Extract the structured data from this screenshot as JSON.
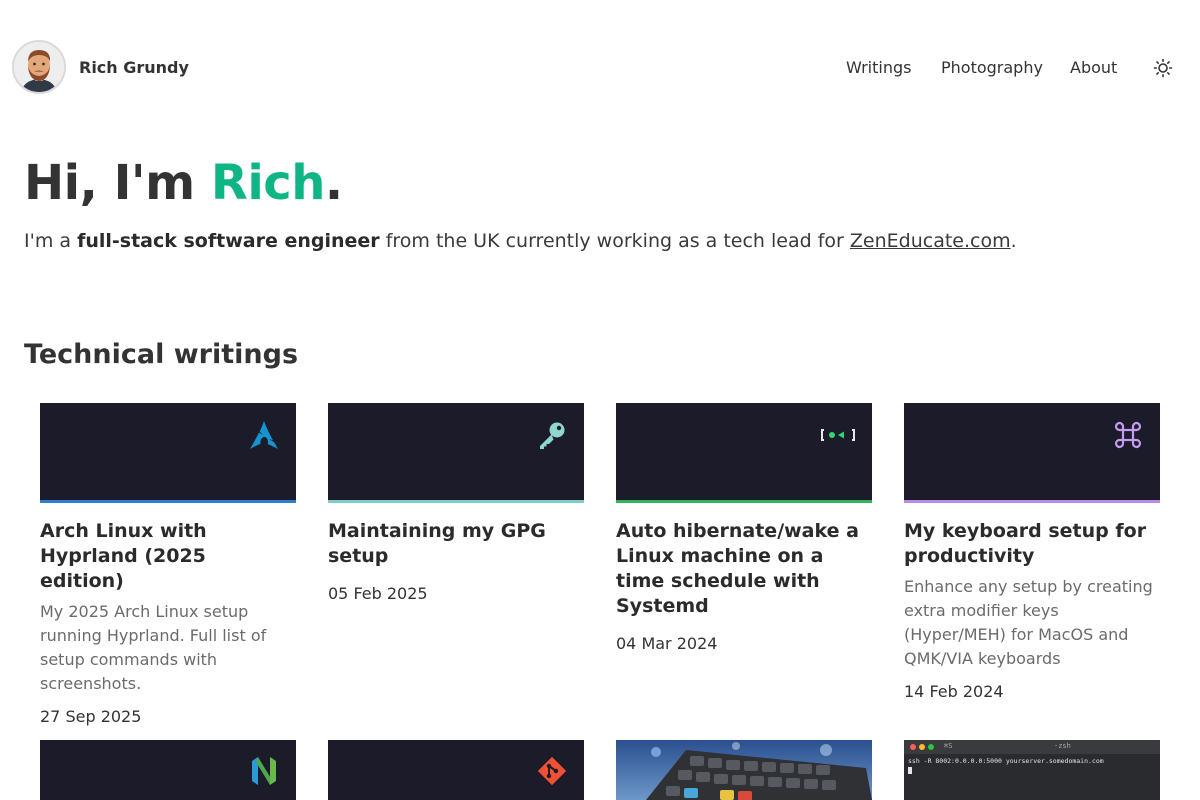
{
  "header": {
    "site_name": "Rich Grundy",
    "nav": [
      {
        "label": "Writings"
      },
      {
        "label": "Photography"
      },
      {
        "label": "About"
      }
    ]
  },
  "hero": {
    "greeting_prefix": "Hi, I'm ",
    "name": "Rich",
    "greeting_suffix": ".",
    "sub_prefix": "I'm a ",
    "sub_bold": "full-stack software engineer",
    "sub_middle": " from the UK currently working as a tech lead for ",
    "sub_link": "ZenEducate.com",
    "sub_suffix": "."
  },
  "writings": {
    "title": "Technical writings",
    "cards": [
      {
        "title": "Arch Linux with Hyprland (2025 edition)",
        "description": "My 2025 Arch Linux setup running Hyprland. Full list of setup commands with screenshots.",
        "date": "27 Sep 2025",
        "icon": "arch-linux-icon",
        "accent": "#2f7fd0"
      },
      {
        "title": "Maintaining my GPG setup",
        "description": "",
        "date": "05 Feb 2025",
        "icon": "key-icon",
        "accent": "#7fcdc6"
      },
      {
        "title": "Auto hibernate/wake a Linux machine on a time schedule with Systemd",
        "description": "",
        "date": "04 Mar 2024",
        "icon": "systemd-icon",
        "accent": "#2fb35a"
      },
      {
        "title": "My keyboard setup for productivity",
        "description": "Enhance any setup by creating extra modifier keys (Hyper/MEH) for MacOS and QMK/VIA keyboards",
        "date": "14 Feb 2024",
        "icon": "command-key-icon",
        "accent": "#b68be6"
      }
    ],
    "row2": [
      {
        "icon": "neovim-icon"
      },
      {
        "icon": "git-icon"
      },
      {
        "icon": "keyboard-photo"
      },
      {
        "icon": "terminal-screenshot",
        "terminal_title": "-zsh",
        "terminal_tab": "⌘S",
        "terminal_command": "ssh -R 8002:0.0.0.0:5000 yourserver.somedomain.com"
      }
    ]
  }
}
